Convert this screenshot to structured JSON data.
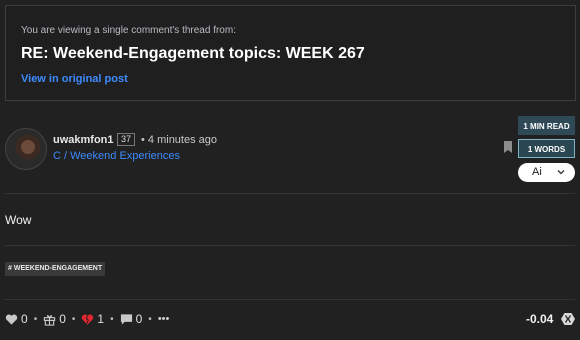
{
  "notice": {
    "text": "You are viewing a single comment's thread from:",
    "title": "RE: Weekend-Engagement topics: WEEK 267",
    "link": "View in original post"
  },
  "author": {
    "name": "uwakmfon1",
    "reputation": "37",
    "time": "• 4 minutes ago",
    "community": "C / Weekend Experiences"
  },
  "badges": {
    "read_time": "1 MIN READ",
    "words": "1 WORDS"
  },
  "ai_select": {
    "label": "Ai"
  },
  "comment": {
    "body": "Wow"
  },
  "tags": [
    "# WEEKEND-ENGAGEMENT"
  ],
  "actions": {
    "likes": "0",
    "gifts": "0",
    "hearts": "1",
    "comments": "0",
    "more": "•••"
  },
  "payout": "-0.04",
  "colors": {
    "background": "#212122",
    "link": "#3d8bfd",
    "heart": "#e0262f",
    "badge": "#2f4a56"
  }
}
